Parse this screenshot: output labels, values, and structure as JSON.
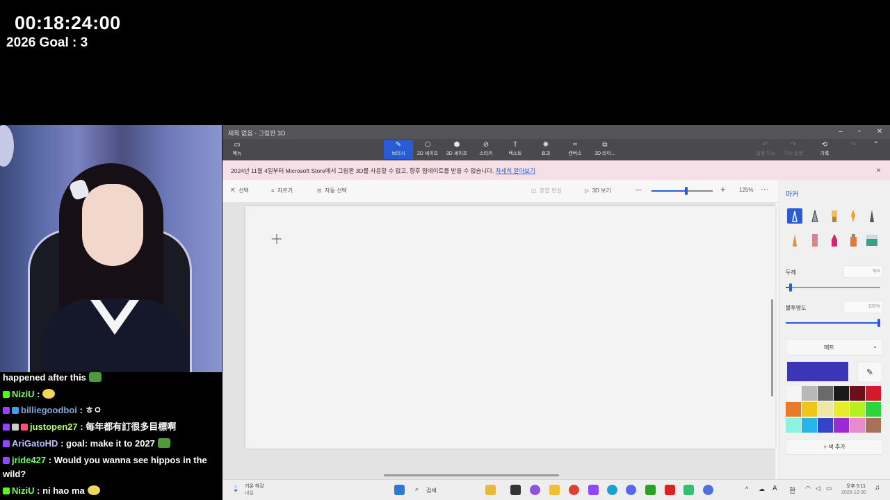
{
  "overlay": {
    "timer": "00:18:24:00",
    "goal": "2026 Goal : 3"
  },
  "chat": [
    {
      "user": "",
      "user_color": "#ffffff",
      "message": "happened after this",
      "badge": "",
      "emote": "pepe"
    },
    {
      "user": "NiziU",
      "user_color": "#7cff5a",
      "message": ":",
      "badge": "#53fc18",
      "emote": "cat"
    },
    {
      "user": "billiegoodboi",
      "user_color": "#7fa8d9",
      "message": ": ㅎㅇ",
      "badge": "#9146ff",
      "emote": ""
    },
    {
      "user": "justopen27",
      "user_color": "#b2ff59",
      "message": ": 每年都有訂很多目標啊",
      "badge": "#9146ff",
      "emote": ""
    },
    {
      "user": "AriGatoHD",
      "user_color": "#c0c0ff",
      "message": ": goal: make it to 2027",
      "badge": "#9146ff",
      "emote": "pepe"
    },
    {
      "user": "jride427",
      "user_color": "#66ff66",
      "message": ": Would you wanna see hippos in the wild?",
      "badge": "#9146ff",
      "emote": ""
    },
    {
      "user": "NiziU",
      "user_color": "#7cff5a",
      "message": ": ni hao ma",
      "badge": "#53fc18",
      "emote": "cat"
    }
  ],
  "window": {
    "title": "제목 없음 - 그림판 3D",
    "controls": {
      "minimize": "–",
      "maximize": "▫",
      "close": "✕"
    },
    "toolbar": [
      {
        "label": "메뉴",
        "icon": "▭"
      },
      {
        "label": "브러시",
        "icon": "✎"
      },
      {
        "label": "2D 셰이프",
        "icon": "⬡"
      },
      {
        "label": "3D 셰이프",
        "icon": "⬢"
      },
      {
        "label": "스티커",
        "icon": "⊘"
      },
      {
        "label": "텍스트",
        "icon": "T"
      },
      {
        "label": "효과",
        "icon": "✺"
      },
      {
        "label": "캔버스",
        "icon": "⌗"
      },
      {
        "label": "3D 라이...",
        "icon": "⧉"
      }
    ],
    "toolbar_right": {
      "history": "기록",
      "history_icon": "⟲",
      "undo": "실행 취소",
      "redo": "다시 실행"
    },
    "notice": {
      "text": "2024년 11월 4일부터 Microsoft Store에서 그림판 3D를 사용할 수 없고, 향후 업데이트를 받을 수 없습니다. ",
      "link": "자세히 알아보기",
      "close": "×"
    },
    "subtoolbar": {
      "select": "선택",
      "crop": "자르기",
      "magic_select": "자동 선택",
      "mixed_reality": "혼합 현실",
      "view_3d": "3D 보기",
      "zoom": "125%",
      "zoom_out": "—",
      "zoom_in": "+",
      "zoom_level": 0.57,
      "more": "···"
    },
    "panel": {
      "title": "마커",
      "thickness_label": "두께",
      "thickness_value": "5px",
      "thickness_level": 0.05,
      "opacity_label": "불투명도",
      "opacity_value": "100%",
      "opacity_level": 1.0,
      "finish_label": "매트",
      "current_color": "#3b36b8",
      "add_color": "+ 색 추가",
      "palette": [
        "#f5f5f5",
        "#b8b8b8",
        "#6a6a6a",
        "#1a1a1a",
        "#6b0f1a",
        "#d11a2a",
        "#e87a2a",
        "#f2c418",
        "#f0e6a8",
        "#e6ec2a",
        "#b6f020",
        "#2ad63a",
        "#8ef2e0",
        "#24b6e8",
        "#3344c8",
        "#9a2ad2",
        "#e88ad0",
        "#a87058"
      ]
    },
    "taskbar": {
      "weather_top": "기온 하강",
      "weather_bottom": "내일",
      "search": "검색",
      "lang": "A",
      "ime": "한",
      "time": "오후 5:11",
      "date": "2025-12-30"
    }
  }
}
